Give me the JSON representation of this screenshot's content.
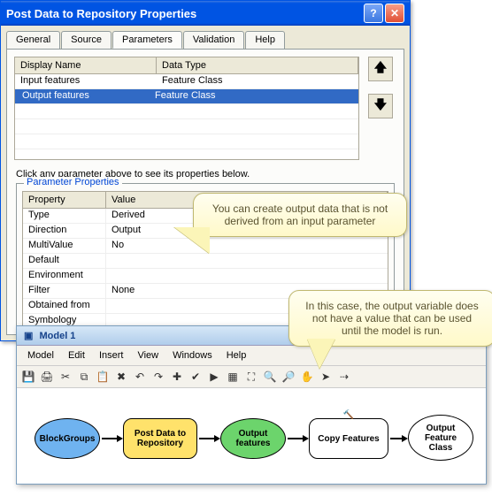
{
  "dialog": {
    "title": "Post Data to Repository Properties",
    "tabs": [
      "General",
      "Source",
      "Parameters",
      "Validation",
      "Help"
    ],
    "active_tab": "Parameters",
    "param_headers": {
      "c1": "Display Name",
      "c2": "Data Type"
    },
    "params": [
      {
        "name": "Input features",
        "type": "Feature Class",
        "selected": false
      },
      {
        "name": "Output features",
        "type": "Feature Class",
        "selected": true
      }
    ],
    "hint": "Click any parameter above to see its properties below.",
    "pp_title": "Parameter Properties",
    "prop_headers": {
      "c1": "Property",
      "c2": "Value"
    },
    "props": [
      {
        "k": "Type",
        "v": "Derived"
      },
      {
        "k": "Direction",
        "v": "Output"
      },
      {
        "k": "MultiValue",
        "v": "No"
      },
      {
        "k": "Default",
        "v": ""
      },
      {
        "k": "Environment",
        "v": ""
      },
      {
        "k": "Filter",
        "v": "None"
      },
      {
        "k": "Obtained from",
        "v": ""
      },
      {
        "k": "Symbology",
        "v": ""
      }
    ]
  },
  "callout1": "You can create output data that is not derived from an input parameter",
  "callout2": "In this case, the output variable does not have a value that can be used until the model is run.",
  "model": {
    "title": "Model 1",
    "menu": [
      "Model",
      "Edit",
      "Insert",
      "View",
      "Windows",
      "Help"
    ],
    "shapes": {
      "s1": "BlockGroups",
      "s2": "Post Data to Repository",
      "s3": "Output features",
      "s4": "Copy Features",
      "s5": "Output Feature Class"
    }
  }
}
